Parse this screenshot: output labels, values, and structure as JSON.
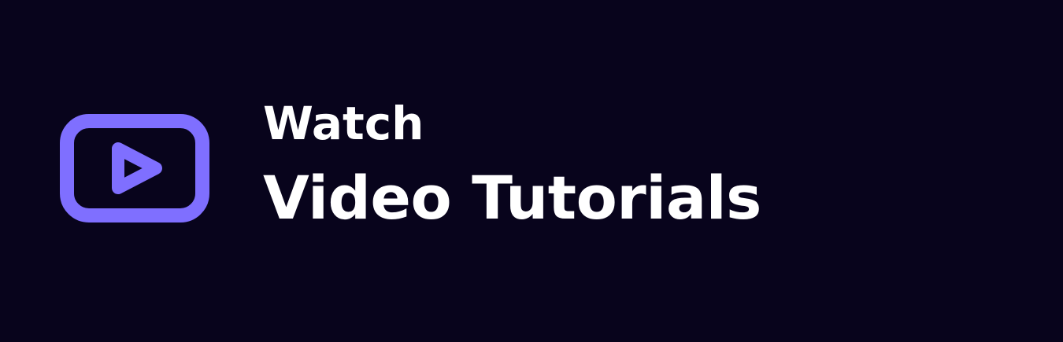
{
  "banner": {
    "eyebrow": "Watch",
    "headline": "Video Tutorials",
    "icon": "play-video-icon",
    "colors": {
      "background": "#08041c",
      "text": "#ffffff",
      "accent": "#7f6fff"
    }
  }
}
